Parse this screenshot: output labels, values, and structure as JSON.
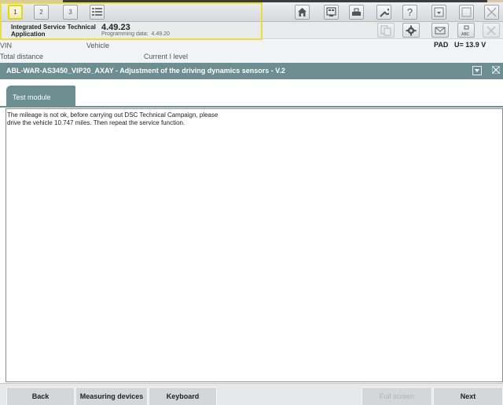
{
  "toolbar": {
    "tabs": [
      {
        "label": "1"
      },
      {
        "label": "2"
      },
      {
        "label": "3"
      }
    ],
    "icons": [
      "list-icon",
      "home-icon",
      "diagnosis-icon",
      "vehicle-icon",
      "wrench-icon",
      "help-icon",
      "minimize-icon",
      "window-icon",
      "close-icon"
    ],
    "help_label": "?"
  },
  "header": {
    "app_name_line1": "Integrated Service Technical",
    "app_name_line2": "Application",
    "version": "4.49.23",
    "programming_label": "Programming data:",
    "programming_value": "4.49.20",
    "abc_label": "ABC"
  },
  "vehicle": {
    "vin_label": "VIN",
    "vehicle_label": "Vehicle",
    "total_distance_label": "Total distance",
    "current_level_label": "Current I level",
    "pad_label": "PAD",
    "voltage": "U=  13.9 V"
  },
  "module": {
    "title": "ABL-WAR-AS3450_VIP20_AXAY - Adjustment of the driving dynamics sensors - V.2",
    "tab_label": "Test module",
    "message": "The mileage is not ok, before carrying out DSC Technical Campaign, please\ndrive the vehicle 10.747 miles. Then repeat the service function."
  },
  "footer": {
    "back": "Back",
    "measuring_devices": "Measuring devices",
    "keyboard": "Keyboard",
    "full_screen": "Full screen",
    "next": "Next"
  },
  "colors": {
    "title_bar": "#6c8e91",
    "highlight": "#e8e03a"
  }
}
